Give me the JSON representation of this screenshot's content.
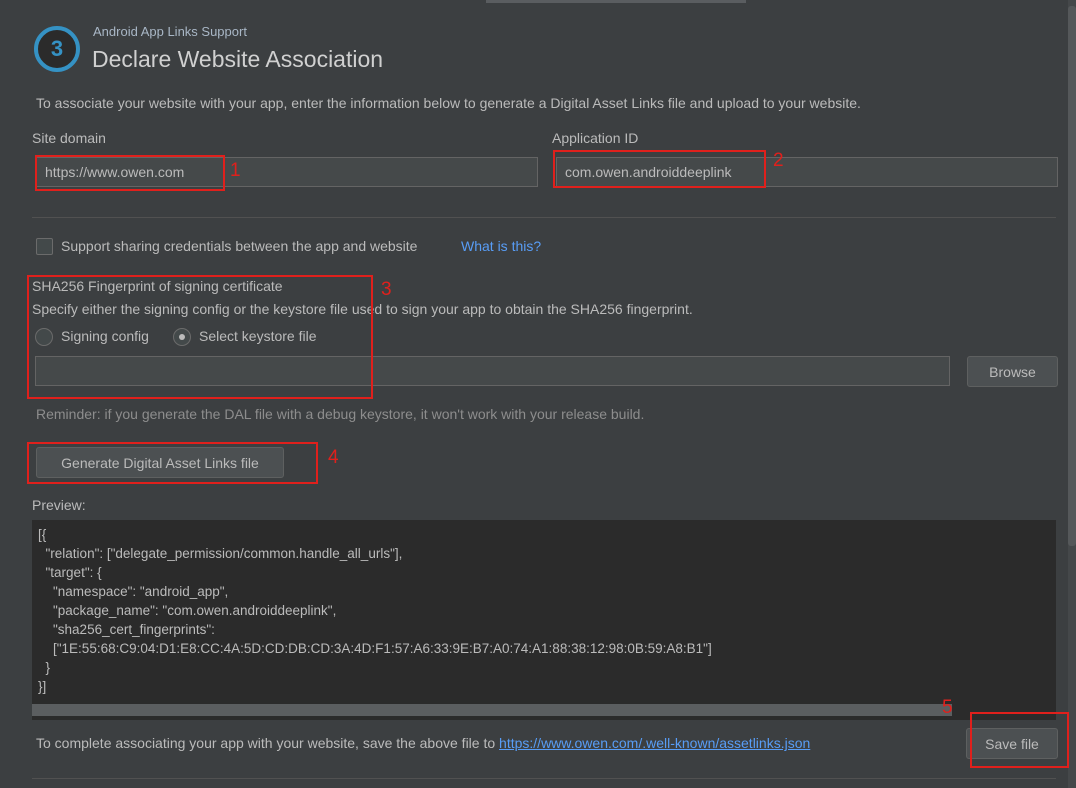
{
  "header": {
    "step_number": "3",
    "supertitle": "Android App Links Support",
    "title": "Declare Website Association",
    "intro": "To associate your website with your app, enter the information below to generate a Digital Asset Links file and upload to your website."
  },
  "fields": {
    "site_domain_label": "Site domain",
    "site_domain_value": "https://www.owen.com",
    "application_id_label": "Application ID",
    "application_id_value": "com.owen.androiddeeplink"
  },
  "credentials": {
    "checkbox_label": "Support sharing credentials between the app and website",
    "checked": false,
    "help_link": "What is this?"
  },
  "fingerprint": {
    "heading": "SHA256 Fingerprint of signing certificate",
    "description": "Specify either the signing config or the keystore file used to sign your app to obtain the SHA256 fingerprint.",
    "radio_signing_config": "Signing config",
    "radio_keystore": "Select keystore file",
    "selected": "Select keystore file",
    "keystore_path": "",
    "browse_label": "Browse",
    "reminder": "Reminder: if you generate the DAL file with a debug keystore, it won't work with your release build."
  },
  "generate_label": "Generate Digital Asset Links file",
  "preview": {
    "label": "Preview:",
    "lines": [
      "[{",
      "  \"relation\": [\"delegate_permission/common.handle_all_urls\"],",
      "  \"target\": {",
      "    \"namespace\": \"android_app\",",
      "    \"package_name\": \"com.owen.androiddeeplink\",",
      "    \"sha256_cert_fingerprints\":",
      "    [\"1E:55:68:C9:04:D1:E8:CC:4A:5D:CD:DB:CD:3A:4D:F1:57:A6:33:9E:B7:A0:74:A1:88:38:12:98:0B:59:A8:B1\"]",
      "  }",
      "}]"
    ]
  },
  "footer": {
    "text": "To complete associating your app with your website, save the above file to ",
    "link": "https://www.owen.com/.well-known/assetlinks.json",
    "save_label": "Save file"
  },
  "annotations": [
    "1",
    "2",
    "3",
    "4",
    "5"
  ],
  "colors": {
    "background": "#3c3f41",
    "accent": "#3592c4",
    "link": "#589df6",
    "annotation": "#e0201c"
  }
}
